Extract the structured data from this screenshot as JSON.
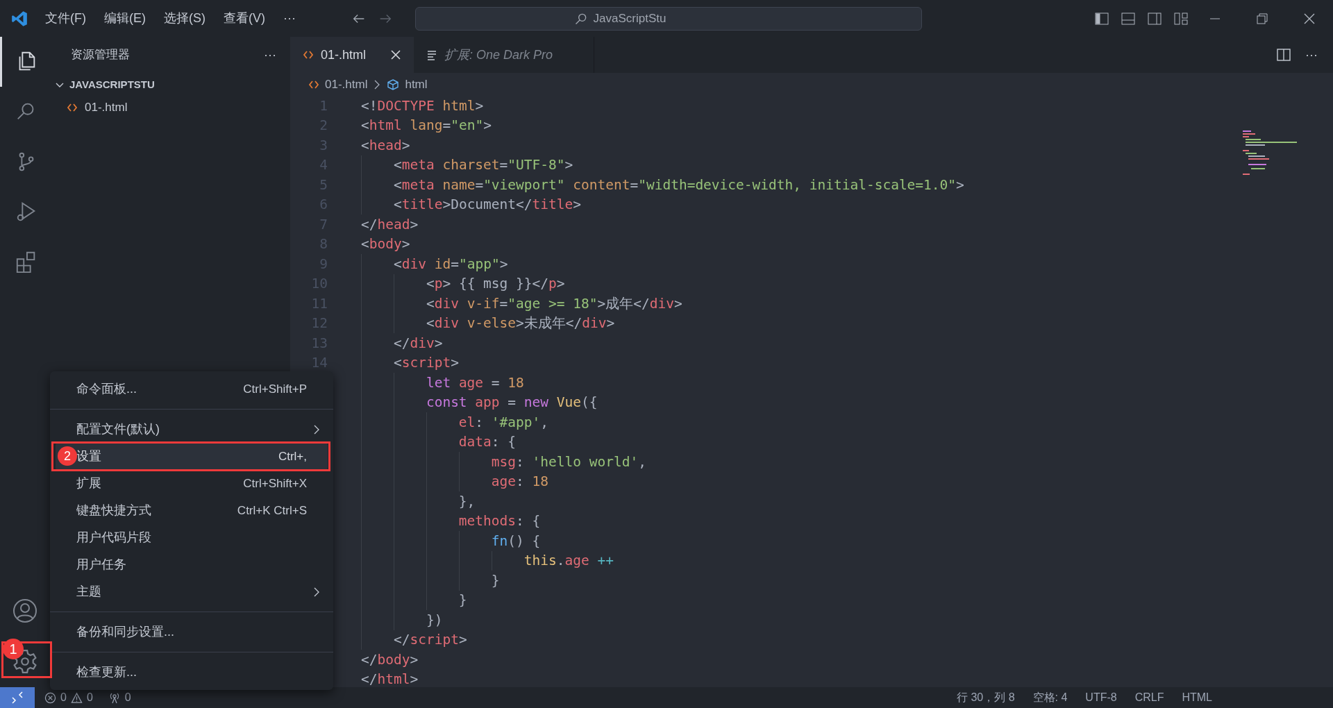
{
  "title_bar": {
    "menus": [
      "文件(F)",
      "编辑(E)",
      "选择(S)",
      "查看(V)"
    ],
    "more": "···",
    "search": "JavaScriptStu"
  },
  "activity_bar": [
    {
      "kind": "files",
      "selected": true
    },
    {
      "kind": "search",
      "selected": false
    },
    {
      "kind": "source-control",
      "selected": false
    },
    {
      "kind": "run",
      "selected": false
    },
    {
      "kind": "extensions",
      "selected": false
    }
  ],
  "sidebar": {
    "title": "资源管理器",
    "more": "···",
    "folder": {
      "name": "JAVASCRIPTSTU",
      "expanded": true,
      "files": [
        "01-.html"
      ]
    }
  },
  "tabs": [
    {
      "label": "01-.html",
      "kind": "file",
      "selected": true
    },
    {
      "label": "扩展: One Dark Pro",
      "kind": "preview",
      "selected": false
    }
  ],
  "editor_actions_more": "···",
  "breadcrumb": [
    "01-.html",
    "html"
  ],
  "code": [
    {
      "number": "1",
      "tokens": [
        {
          "kind": "p",
          "text": "<!"
        },
        {
          "kind": "tag",
          "text": "DOCTYPE"
        },
        {
          "kind": "attr",
          "text": " html"
        },
        {
          "kind": "p",
          "text": ">"
        }
      ]
    },
    {
      "number": "2",
      "tokens": [
        {
          "kind": "p",
          "text": "<"
        },
        {
          "kind": "tag",
          "text": "html"
        },
        {
          "kind": "attr",
          "text": " lang"
        },
        {
          "kind": "p",
          "text": "="
        },
        {
          "kind": "str",
          "text": "\"en\""
        },
        {
          "kind": "p",
          "text": ">"
        }
      ]
    },
    {
      "number": "3",
      "tokens": [
        {
          "kind": "p",
          "text": "<"
        },
        {
          "kind": "tag",
          "text": "head"
        },
        {
          "kind": "p",
          "text": ">"
        }
      ],
      "children": [
        {
          "number": "4",
          "tokens": [
            {
              "kind": "p",
              "text": "<"
            },
            {
              "kind": "tag",
              "text": "meta"
            },
            {
              "kind": "attr",
              "text": " charset"
            },
            {
              "kind": "p",
              "text": "="
            },
            {
              "kind": "str",
              "text": "\"UTF-8\""
            },
            {
              "kind": "p",
              "text": ">"
            }
          ]
        },
        {
          "number": "5",
          "tokens": [
            {
              "kind": "p",
              "text": "<"
            },
            {
              "kind": "tag",
              "text": "meta"
            },
            {
              "kind": "attr",
              "text": " name"
            },
            {
              "kind": "p",
              "text": "="
            },
            {
              "kind": "str",
              "text": "\"viewport\""
            },
            {
              "kind": "attr",
              "text": " content"
            },
            {
              "kind": "p",
              "text": "="
            },
            {
              "kind": "str",
              "text": "\"width=device-width, initial-scale=1.0\""
            },
            {
              "kind": "p",
              "text": ">"
            }
          ]
        },
        {
          "number": "6",
          "tokens": [
            {
              "kind": "p",
              "text": "<"
            },
            {
              "kind": "tag",
              "text": "title"
            },
            {
              "kind": "p",
              "text": ">Document</"
            },
            {
              "kind": "tag",
              "text": "title"
            },
            {
              "kind": "p",
              "text": ">"
            }
          ]
        }
      ]
    },
    {
      "number": "7",
      "tokens": [
        {
          "kind": "p",
          "text": "</"
        },
        {
          "kind": "tag",
          "text": "head"
        },
        {
          "kind": "p",
          "text": ">"
        }
      ]
    },
    {
      "number": "8",
      "tokens": [
        {
          "kind": "p",
          "text": "<"
        },
        {
          "kind": "tag",
          "text": "body"
        },
        {
          "kind": "p",
          "text": ">"
        }
      ],
      "children": [
        {
          "number": "9",
          "tokens": [
            {
              "kind": "p",
              "text": "<"
            },
            {
              "kind": "tag",
              "text": "div"
            },
            {
              "kind": "attr",
              "text": " id"
            },
            {
              "kind": "p",
              "text": "="
            },
            {
              "kind": "str",
              "text": "\"app\""
            },
            {
              "kind": "p",
              "text": ">"
            }
          ],
          "children": [
            {
              "number": "10",
              "tokens": [
                {
                  "kind": "p",
                  "text": "<"
                },
                {
                  "kind": "tag",
                  "text": "p"
                },
                {
                  "kind": "p",
                  "text": "> {{ msg }}</"
                },
                {
                  "kind": "tag",
                  "text": "p"
                },
                {
                  "kind": "p",
                  "text": ">"
                }
              ]
            },
            {
              "number": "11",
              "tokens": [
                {
                  "kind": "p",
                  "text": "<"
                },
                {
                  "kind": "tag",
                  "text": "div"
                },
                {
                  "kind": "attr",
                  "text": " v-if"
                },
                {
                  "kind": "p",
                  "text": "="
                },
                {
                  "kind": "str",
                  "text": "\"age >= 18\""
                },
                {
                  "kind": "p",
                  "text": ">成年</"
                },
                {
                  "kind": "tag",
                  "text": "div"
                },
                {
                  "kind": "p",
                  "text": ">"
                }
              ]
            },
            {
              "number": "12",
              "tokens": [
                {
                  "kind": "p",
                  "text": "<"
                },
                {
                  "kind": "tag",
                  "text": "div"
                },
                {
                  "kind": "attr",
                  "text": " v-else"
                },
                {
                  "kind": "p",
                  "text": ">未成年</"
                },
                {
                  "kind": "tag",
                  "text": "div"
                },
                {
                  "kind": "p",
                  "text": ">"
                }
              ]
            }
          ]
        },
        {
          "number": "13",
          "tokens": [
            {
              "kind": "p",
              "text": "</"
            },
            {
              "kind": "tag",
              "text": "div"
            },
            {
              "kind": "p",
              "text": ">"
            }
          ]
        },
        {
          "number": "14",
          "tokens": [
            {
              "kind": "p",
              "text": "<"
            },
            {
              "kind": "tag",
              "text": "script"
            },
            {
              "kind": "p",
              "text": ">"
            }
          ],
          "children": [
            {
              "tokens": [
                {
                  "kind": "kw",
                  "text": "let"
                },
                {
                  "kind": "var",
                  "text": " age"
                },
                {
                  "kind": "p",
                  "text": " = "
                },
                {
                  "kind": "num",
                  "text": "18"
                }
              ]
            },
            {
              "tokens": [
                {
                  "kind": "kw",
                  "text": "const"
                },
                {
                  "kind": "var",
                  "text": " app"
                },
                {
                  "kind": "p",
                  "text": " = "
                },
                {
                  "kind": "kw",
                  "text": "new"
                },
                {
                  "kind": "cls",
                  "text": " Vue"
                },
                {
                  "kind": "p",
                  "text": "({"
                }
              ],
              "children": [
                {
                  "tokens": [
                    {
                      "kind": "var",
                      "text": "el"
                    },
                    {
                      "kind": "p",
                      "text": ": "
                    },
                    {
                      "kind": "str",
                      "text": "'#app'"
                    },
                    {
                      "kind": "p",
                      "text": ","
                    }
                  ]
                },
                {
                  "tokens": [
                    {
                      "kind": "var",
                      "text": "data"
                    },
                    {
                      "kind": "p",
                      "text": ": {"
                    }
                  ],
                  "children": [
                    {
                      "tokens": [
                        {
                          "kind": "var",
                          "text": "msg"
                        },
                        {
                          "kind": "p",
                          "text": ": "
                        },
                        {
                          "kind": "str",
                          "text": "'hello world'"
                        },
                        {
                          "kind": "p",
                          "text": ","
                        }
                      ]
                    },
                    {
                      "tokens": [
                        {
                          "kind": "var",
                          "text": "age"
                        },
                        {
                          "kind": "p",
                          "text": ": "
                        },
                        {
                          "kind": "num",
                          "text": "18"
                        }
                      ]
                    }
                  ]
                },
                {
                  "tokens": [
                    {
                      "kind": "p",
                      "text": "},"
                    }
                  ]
                },
                {
                  "tokens": [
                    {
                      "kind": "var",
                      "text": "methods"
                    },
                    {
                      "kind": "p",
                      "text": ": {"
                    }
                  ],
                  "children": [
                    {
                      "tokens": [
                        {
                          "kind": "fn",
                          "text": "fn"
                        },
                        {
                          "kind": "p",
                          "text": "() {"
                        }
                      ],
                      "children": [
                        {
                          "tokens": [
                            {
                              "kind": "cls",
                              "text": "this"
                            },
                            {
                              "kind": "p",
                              "text": "."
                            },
                            {
                              "kind": "var",
                              "text": "age"
                            },
                            {
                              "kind": "op",
                              "text": " ++"
                            }
                          ]
                        }
                      ]
                    },
                    {
                      "tokens": [
                        {
                          "kind": "p",
                          "text": "}"
                        }
                      ]
                    }
                  ]
                },
                {
                  "tokens": [
                    {
                      "kind": "p",
                      "text": "}"
                    }
                  ]
                }
              ]
            },
            {
              "tokens": [
                {
                  "kind": "p",
                  "text": "})"
                }
              ]
            }
          ]
        },
        {
          "tokens": [
            {
              "kind": "p",
              "text": "</"
            },
            {
              "kind": "tag",
              "text": "script"
            },
            {
              "kind": "p",
              "text": ">"
            }
          ]
        }
      ]
    },
    {
      "tokens": [
        {
          "kind": "p",
          "text": "</"
        },
        {
          "kind": "tag",
          "text": "body"
        },
        {
          "kind": "p",
          "text": ">"
        }
      ]
    },
    {
      "tokens": [
        {
          "kind": "p",
          "text": "</"
        },
        {
          "kind": "tag",
          "text": "html"
        },
        {
          "kind": "p",
          "text": ">"
        }
      ]
    }
  ],
  "menu": {
    "items": [
      {
        "kind": "item",
        "label": "命令面板...",
        "shortcut": "Ctrl+Shift+P",
        "selected": false
      },
      {
        "kind": "separator"
      },
      {
        "kind": "submenu",
        "label": "配置文件(默认)",
        "selected": false
      },
      {
        "kind": "item",
        "label": "设置",
        "shortcut": "Ctrl+,",
        "selected": true,
        "callout": "2"
      },
      {
        "kind": "item",
        "label": "扩展",
        "shortcut": "Ctrl+Shift+X",
        "selected": false
      },
      {
        "kind": "item",
        "label": "键盘快捷方式",
        "shortcut": "Ctrl+K Ctrl+S",
        "selected": false
      },
      {
        "kind": "item",
        "label": "用户代码片段",
        "selected": false
      },
      {
        "kind": "item",
        "label": "用户任务",
        "selected": false
      },
      {
        "kind": "submenu",
        "label": "主题",
        "selected": false
      },
      {
        "kind": "separator"
      },
      {
        "kind": "item",
        "label": "备份和同步设置...",
        "selected": false
      },
      {
        "kind": "separator"
      },
      {
        "kind": "item",
        "label": "检查更新...",
        "selected": false
      }
    ]
  },
  "manage_callout": "1",
  "status_bar": {
    "errors": "0",
    "warnings": "0",
    "ports": "0",
    "right": [
      "行 30，列 8",
      "空格: 4",
      "UTF-8",
      "CRLF",
      "HTML"
    ]
  }
}
